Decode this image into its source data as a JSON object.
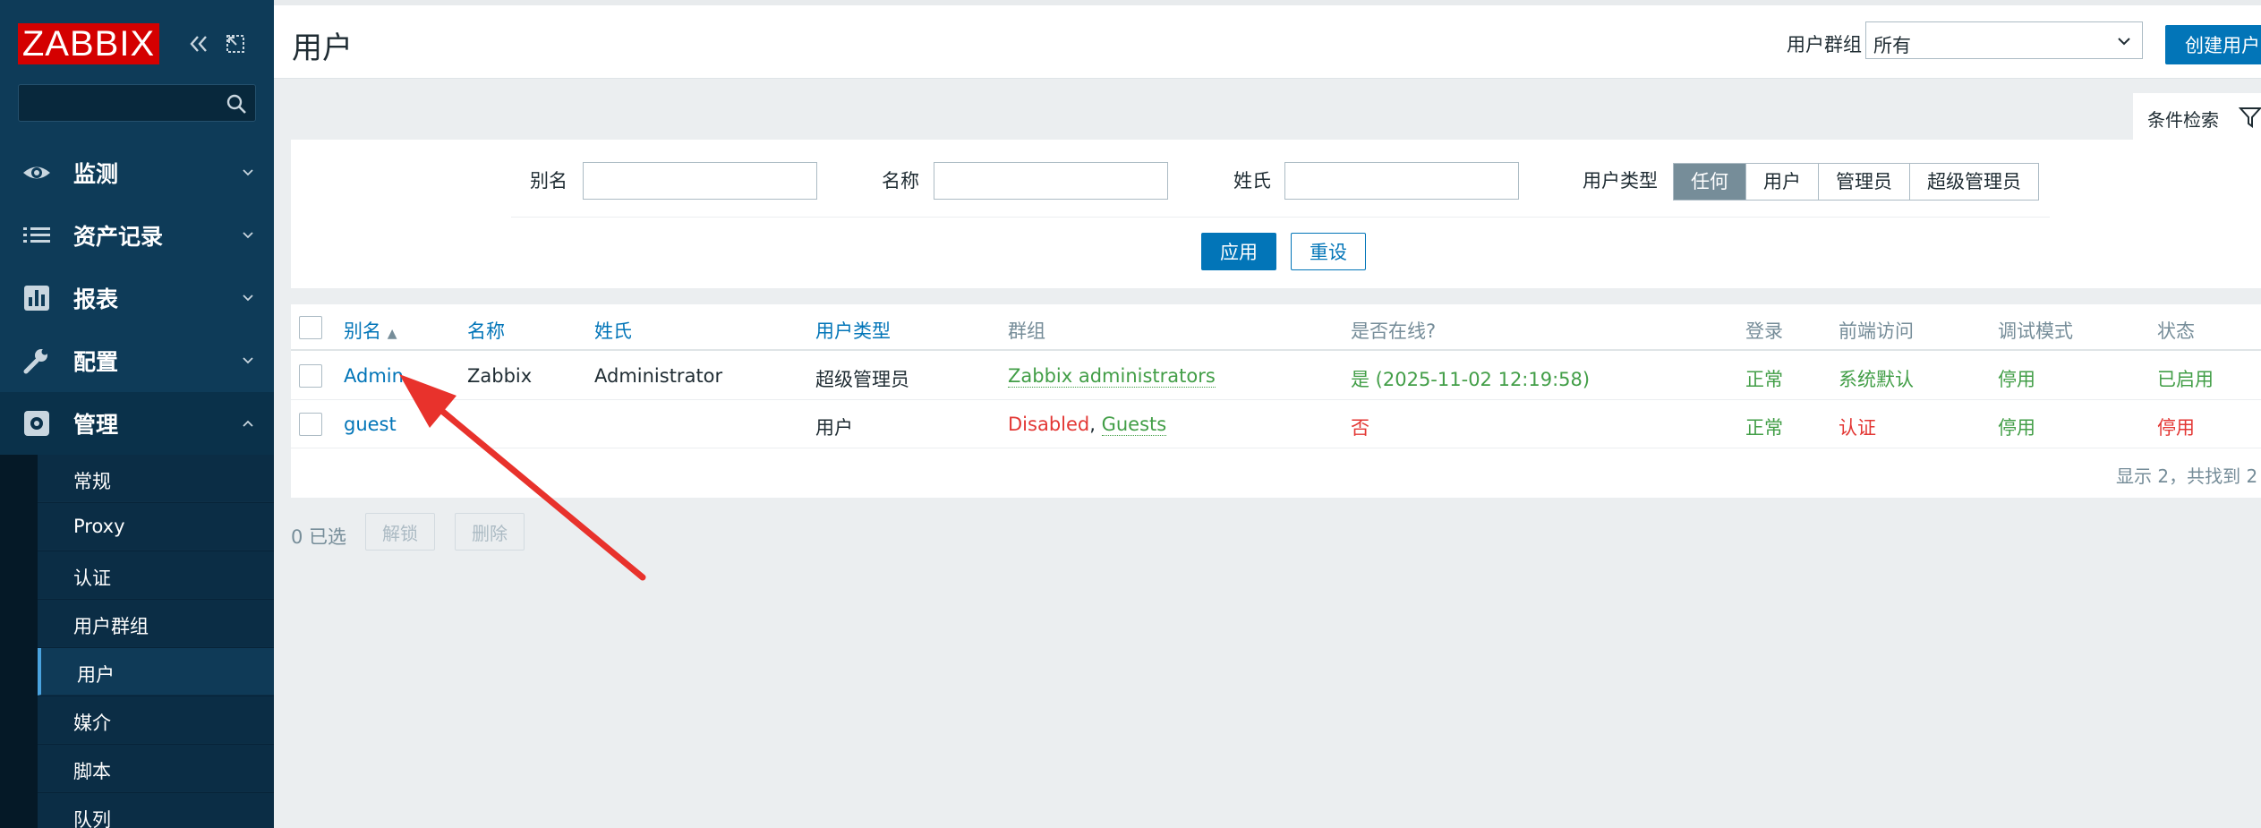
{
  "sidebar": {
    "logo": "ZABBIX",
    "search_placeholder": "",
    "menu": [
      {
        "label": "监测",
        "icon": "eye-icon"
      },
      {
        "label": "资产记录",
        "icon": "list-icon"
      },
      {
        "label": "报表",
        "icon": "bar-chart-icon"
      },
      {
        "label": "配置",
        "icon": "wrench-icon"
      },
      {
        "label": "管理",
        "icon": "gear-icon"
      }
    ],
    "submenu": [
      "常规",
      "Proxy",
      "认证",
      "用户群组",
      "用户",
      "媒介",
      "脚本",
      "队列"
    ]
  },
  "header": {
    "title": "用户",
    "group_label": "用户群组",
    "group_value": "所有",
    "create_button": "创建用户"
  },
  "filter": {
    "tab_label": "条件检索",
    "alias_label": "别名",
    "name_label": "名称",
    "surname_label": "姓氏",
    "type_label": "用户类型",
    "type_options": [
      "任何",
      "用户",
      "管理员",
      "超级管理员"
    ],
    "type_selected": "任何",
    "apply": "应用",
    "reset": "重设"
  },
  "table": {
    "headers": {
      "alias": "别名",
      "name": "名称",
      "surname": "姓氏",
      "type": "用户类型",
      "groups": "群组",
      "online": "是否在线?",
      "login": "登录",
      "frontend": "前端访问",
      "debug": "调试模式",
      "status": "状态"
    },
    "rows": [
      {
        "alias": "Admin",
        "name": "Zabbix",
        "surname": "Administrator",
        "type": "超级管理员",
        "groups": [
          "Zabbix administrators"
        ],
        "online": "是 (2025-11-02 12:19:58)",
        "login": "正常",
        "frontend": "系统默认",
        "debug": "停用",
        "status": "已启用"
      },
      {
        "alias": "guest",
        "name": "",
        "surname": "",
        "type": "用户",
        "groups_disabled": "Disabled",
        "groups_sep": ", ",
        "groups": [
          "Guests"
        ],
        "online": "否",
        "login": "正常",
        "frontend": "认证",
        "debug": "停用",
        "status": "停用"
      }
    ],
    "summary": "显示 2，共找到 2"
  },
  "footer": {
    "selected": "0 已选",
    "unblock": "解锁",
    "delete": "删除"
  },
  "colors": {
    "sidebar": "#0e3b58",
    "logo": "#d40000",
    "primary": "#0275b8",
    "green": "#429e47",
    "red": "#e33734",
    "annotation_arrow": "#e8322c"
  }
}
